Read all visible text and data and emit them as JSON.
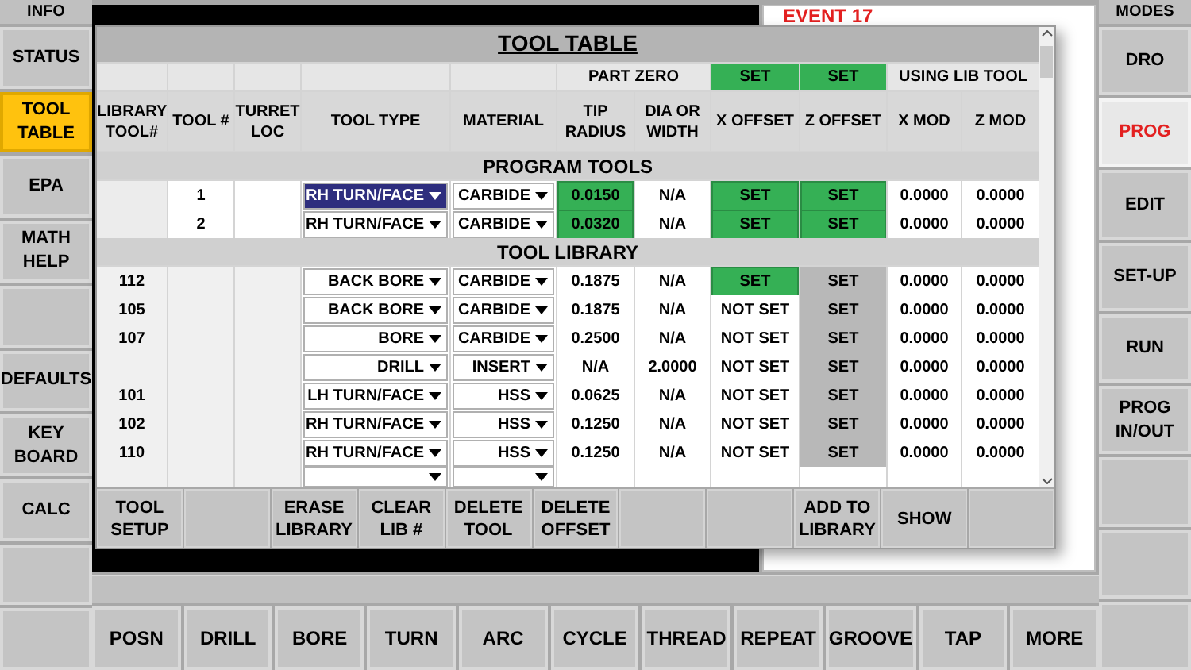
{
  "left_sidebar": {
    "header": "INFO",
    "items": [
      {
        "label": "STATUS",
        "selected": false
      },
      {
        "label": "TOOL TABLE",
        "selected": true
      },
      {
        "label": "EPA",
        "selected": false
      },
      {
        "label": "MATH HELP",
        "selected": false
      },
      {
        "selected": false
      },
      {
        "label": "DEFAULTS",
        "selected": false
      },
      {
        "label": "KEY BOARD",
        "selected": false
      },
      {
        "label": "CALC",
        "selected": false
      },
      {
        "selected": false
      },
      {
        "selected": false
      }
    ]
  },
  "right_sidebar": {
    "header": "MODES",
    "items": [
      {
        "label": "DRO",
        "selected": false
      },
      {
        "label": "PROG",
        "selected": true
      },
      {
        "label": "EDIT",
        "selected": false
      },
      {
        "label": "SET-UP",
        "selected": false
      },
      {
        "label": "RUN",
        "selected": false
      },
      {
        "label": "PROG IN/OUT",
        "selected": false
      },
      {
        "selected": false
      },
      {
        "selected": false
      },
      {
        "selected": false
      }
    ]
  },
  "event_label": "EVENT 17",
  "dialog": {
    "title": "TOOL TABLE",
    "part_zero": {
      "label": "PART ZERO",
      "x": {
        "text": "SET",
        "highlight": true
      },
      "z": {
        "text": "SET",
        "highlight": true
      },
      "note": "USING LIB TOOL"
    },
    "columns": [
      "LIBRARY TOOL#",
      "TOOL #",
      "TURRET LOC",
      "TOOL TYPE",
      "MATERIAL",
      "TIP RADIUS",
      "DIA OR WIDTH",
      "X OFFSET",
      "Z OFFSET",
      "X MOD",
      "Z MOD"
    ],
    "sections": [
      {
        "title": "PROGRAM TOOLS",
        "rows": [
          {
            "kind": "program",
            "tool_no": "1",
            "tool_type": {
              "value": "RH TURN/FACE",
              "selected": true
            },
            "material": "CARBIDE",
            "tip_radius": {
              "text": "0.0150",
              "highlight": true
            },
            "dia": "N/A",
            "x_offset": {
              "text": "SET",
              "highlight": true
            },
            "z_offset": {
              "text": "SET",
              "highlight": true
            },
            "x_mod": "0.0000",
            "z_mod": "0.0000"
          },
          {
            "kind": "program",
            "tool_no": "2",
            "tool_type": {
              "value": "RH TURN/FACE",
              "selected": false
            },
            "material": "CARBIDE",
            "tip_radius": {
              "text": "0.0320",
              "highlight": true
            },
            "dia": "N/A",
            "x_offset": {
              "text": "SET",
              "highlight": true
            },
            "z_offset": {
              "text": "SET",
              "highlight": true
            },
            "x_mod": "0.0000",
            "z_mod": "0.0000"
          }
        ]
      },
      {
        "title": "TOOL LIBRARY",
        "rows": [
          {
            "kind": "library",
            "library_tool": "112",
            "tool_type": {
              "value": "BACK BORE",
              "selected": false
            },
            "material": "CARBIDE",
            "tip_radius": {
              "text": "0.1875",
              "highlight": false
            },
            "dia": "N/A",
            "x_offset": {
              "text": "SET",
              "highlight": true
            },
            "z_offset": {
              "text": "SET",
              "highlight": false
            },
            "x_mod": "0.0000",
            "z_mod": "0.0000"
          },
          {
            "kind": "library",
            "library_tool": "105",
            "tool_type": {
              "value": "BACK BORE",
              "selected": false
            },
            "material": "CARBIDE",
            "tip_radius": {
              "text": "0.1875",
              "highlight": false
            },
            "dia": "N/A",
            "x_offset": {
              "text": "NOT SET",
              "highlight": false
            },
            "z_offset": {
              "text": "SET",
              "highlight": false
            },
            "x_mod": "0.0000",
            "z_mod": "0.0000"
          },
          {
            "kind": "library",
            "library_tool": "107",
            "tool_type": {
              "value": "BORE",
              "selected": false
            },
            "material": "CARBIDE",
            "tip_radius": {
              "text": "0.2500",
              "highlight": false
            },
            "dia": "N/A",
            "x_offset": {
              "text": "NOT SET",
              "highlight": false
            },
            "z_offset": {
              "text": "SET",
              "highlight": false
            },
            "x_mod": "0.0000",
            "z_mod": "0.0000"
          },
          {
            "kind": "library",
            "tool_type": {
              "value": "DRILL",
              "selected": false
            },
            "material": "INSERT",
            "tip_radius": {
              "text": "N/A",
              "highlight": false
            },
            "dia": "2.0000",
            "x_offset": {
              "text": "NOT SET",
              "highlight": false
            },
            "z_offset": {
              "text": "SET",
              "highlight": false
            },
            "x_mod": "0.0000",
            "z_mod": "0.0000"
          },
          {
            "kind": "library",
            "library_tool": "101",
            "tool_type": {
              "value": "LH TURN/FACE",
              "selected": false
            },
            "material": "HSS",
            "tip_radius": {
              "text": "0.0625",
              "highlight": false
            },
            "dia": "N/A",
            "x_offset": {
              "text": "NOT SET",
              "highlight": false
            },
            "z_offset": {
              "text": "SET",
              "highlight": false
            },
            "x_mod": "0.0000",
            "z_mod": "0.0000"
          },
          {
            "kind": "library",
            "library_tool": "102",
            "tool_type": {
              "value": "RH TURN/FACE",
              "selected": false
            },
            "material": "HSS",
            "tip_radius": {
              "text": "0.1250",
              "highlight": false
            },
            "dia": "N/A",
            "x_offset": {
              "text": "NOT SET",
              "highlight": false
            },
            "z_offset": {
              "text": "SET",
              "highlight": false
            },
            "x_mod": "0.0000",
            "z_mod": "0.0000"
          },
          {
            "kind": "library",
            "library_tool": "110",
            "tool_type": {
              "value": "RH TURN/FACE",
              "selected": false
            },
            "material": "HSS",
            "tip_radius": {
              "text": "0.1250",
              "highlight": false
            },
            "dia": "N/A",
            "x_offset": {
              "text": "NOT SET",
              "highlight": false
            },
            "z_offset": {
              "text": "SET",
              "highlight": false
            },
            "x_mod": "0.0000",
            "z_mod": "0.0000"
          },
          {
            "kind": "blank"
          }
        ]
      }
    ],
    "buttons": [
      {
        "kind": "label",
        "label": "TOOL SETUP"
      },
      {
        "kind": "blank"
      },
      {
        "kind": "label",
        "label": "ERASE LIBRARY"
      },
      {
        "kind": "label",
        "label": "CLEAR LIB #"
      },
      {
        "kind": "label",
        "label": "DELETE TOOL"
      },
      {
        "kind": "label",
        "label": "DELETE OFFSET"
      },
      {
        "kind": "blank"
      },
      {
        "kind": "blank"
      },
      {
        "kind": "label",
        "label": "ADD TO LIBRARY"
      },
      {
        "kind": "label",
        "label": "SHOW"
      },
      {
        "kind": "blank"
      }
    ]
  },
  "bottom_bar": [
    "POSN",
    "DRILL",
    "BORE",
    "TURN",
    "ARC",
    "CYCLE",
    "THREAD",
    "REPEAT",
    "GROOVE",
    "TAP",
    "MORE"
  ]
}
